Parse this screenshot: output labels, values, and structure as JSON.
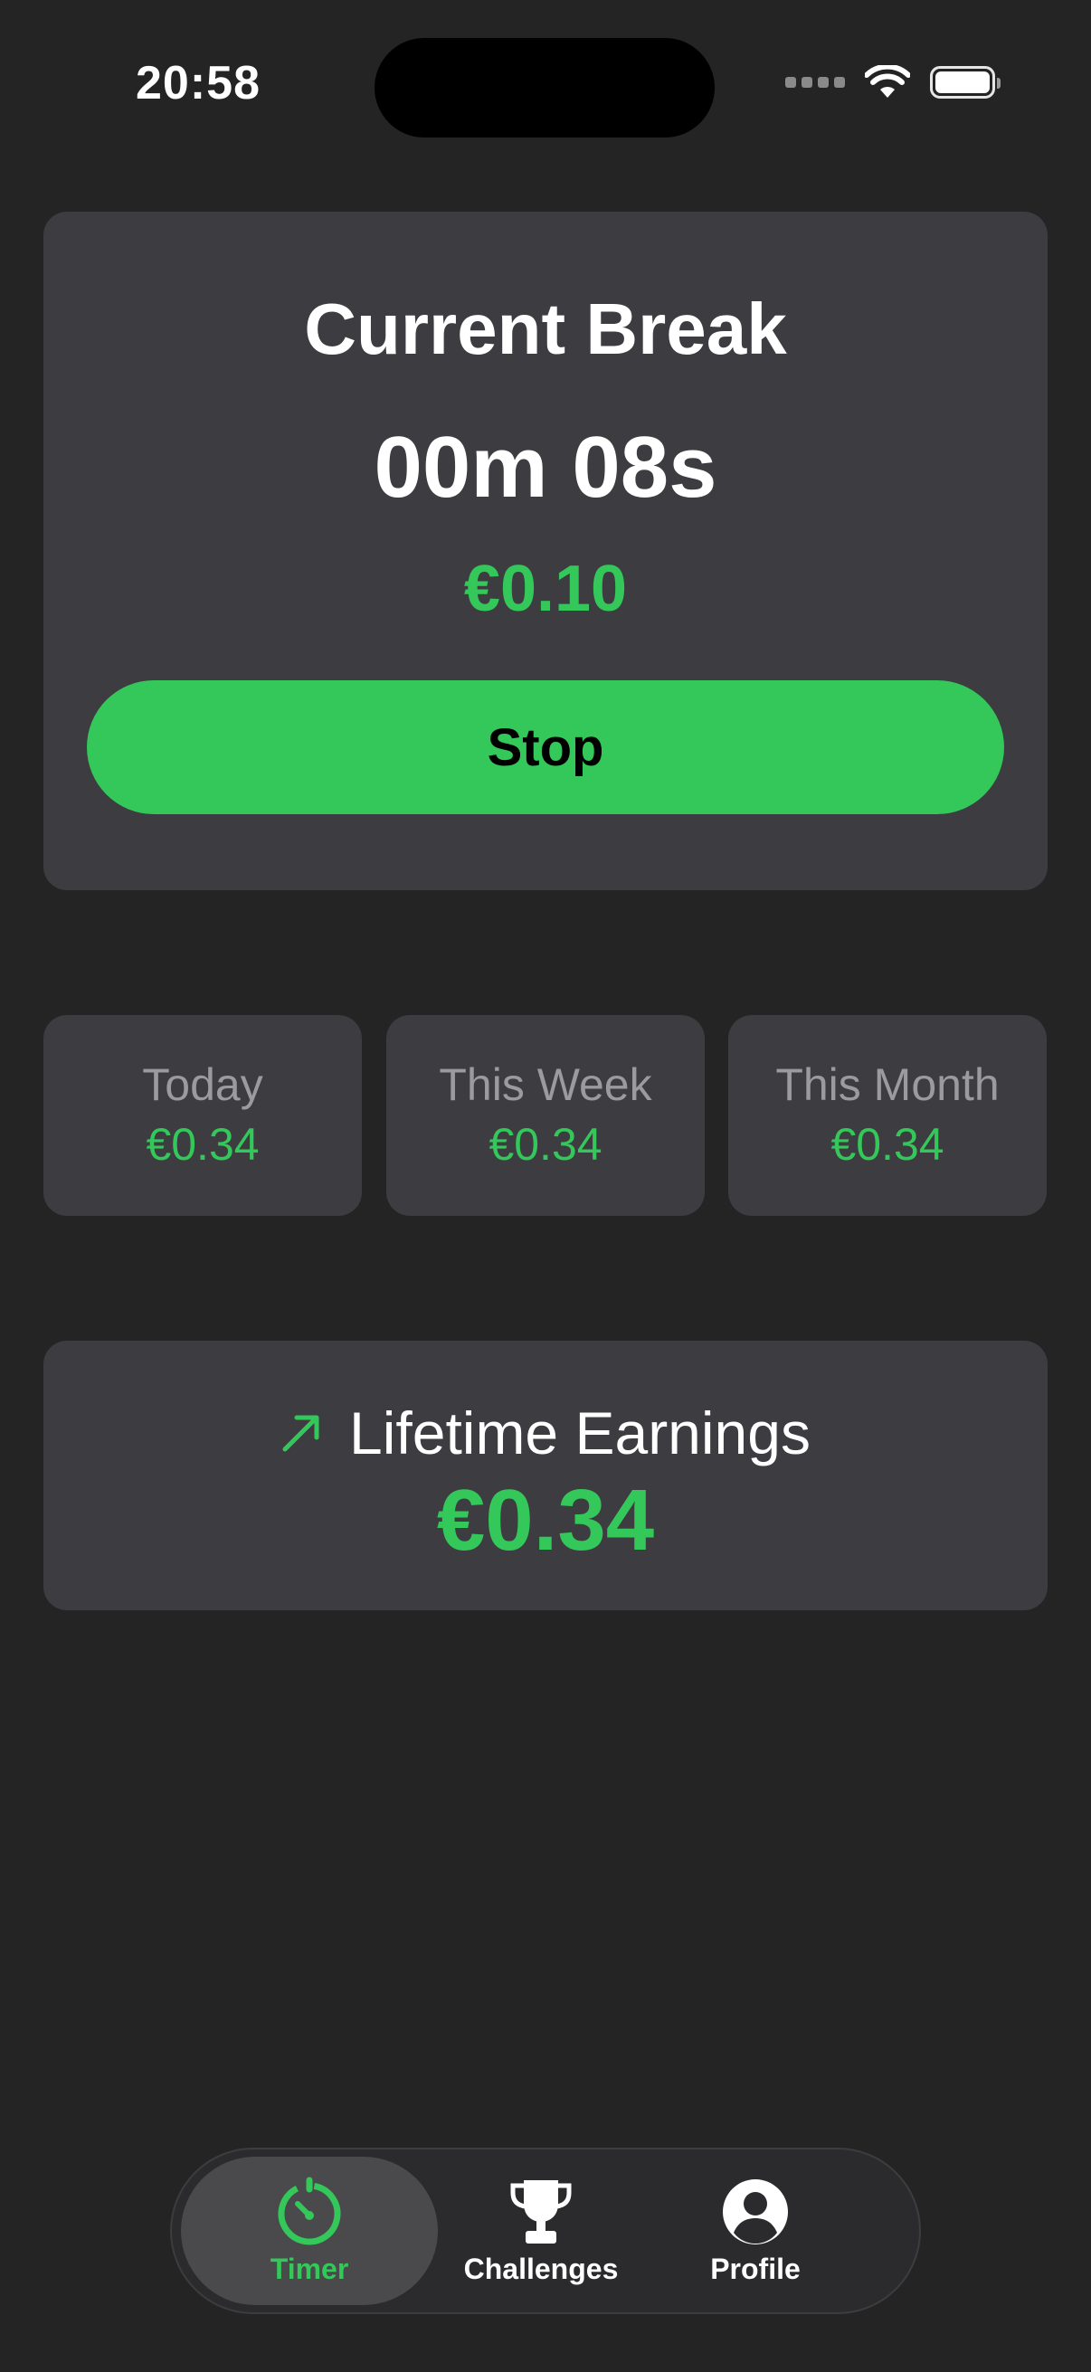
{
  "status_bar": {
    "time": "20:58"
  },
  "current_break": {
    "title": "Current Break",
    "timer": "00m 08s",
    "amount": "€0.10",
    "stop_label": "Stop"
  },
  "stats": [
    {
      "label": "Today",
      "value": "€0.34"
    },
    {
      "label": "This Week",
      "value": "€0.34"
    },
    {
      "label": "This Month",
      "value": "€0.34"
    }
  ],
  "lifetime": {
    "title": "Lifetime Earnings",
    "value": "€0.34",
    "icon": "trend-arrow-icon"
  },
  "tab_bar": {
    "active": "Timer",
    "tabs": [
      {
        "label": "Timer",
        "icon": "timer-icon"
      },
      {
        "label": "Challenges",
        "icon": "trophy-icon"
      },
      {
        "label": "Profile",
        "icon": "profile-icon"
      }
    ]
  },
  "colors": {
    "background": "#242424",
    "card": "#3c3c41",
    "accent_green": "#34c759",
    "muted_text": "#9a9a9f"
  }
}
